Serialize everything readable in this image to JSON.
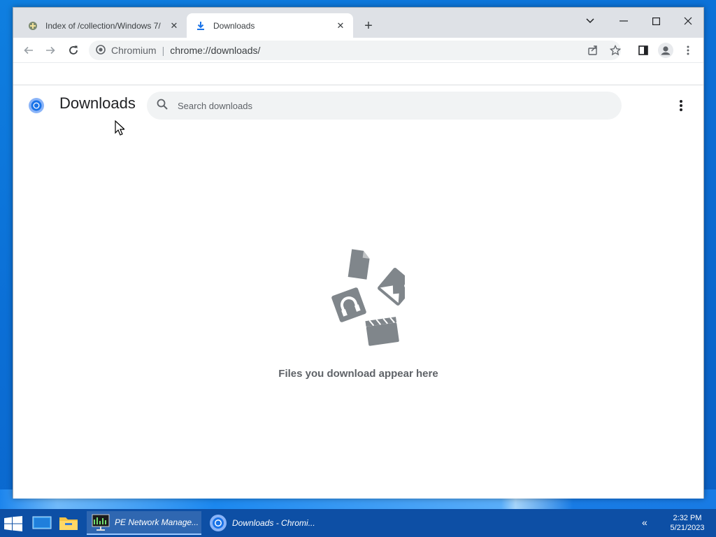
{
  "browser": {
    "tabs": [
      {
        "title": "Index of /collection/Windows 7/",
        "icon": "folder-favicon-icon",
        "active": false
      },
      {
        "title": "Downloads",
        "icon": "download-icon",
        "active": true
      }
    ],
    "toolbar": {
      "site_name": "Chromium",
      "url": "chrome://downloads/"
    }
  },
  "page": {
    "title": "Downloads",
    "search_placeholder": "Search downloads",
    "empty_message": "Files you download appear here"
  },
  "taskbar": {
    "items": [
      {
        "label": "PE Network Manage...",
        "icon": "network-manager-icon"
      },
      {
        "label": "Downloads - Chromi...",
        "icon": "chromium-icon"
      }
    ],
    "clock": {
      "time": "2:32 PM",
      "date": "5/21/2023"
    }
  },
  "colors": {
    "accent": "#1a73e8",
    "taskbar": "#0d4fa5",
    "desktop": "#0b6fd6"
  }
}
